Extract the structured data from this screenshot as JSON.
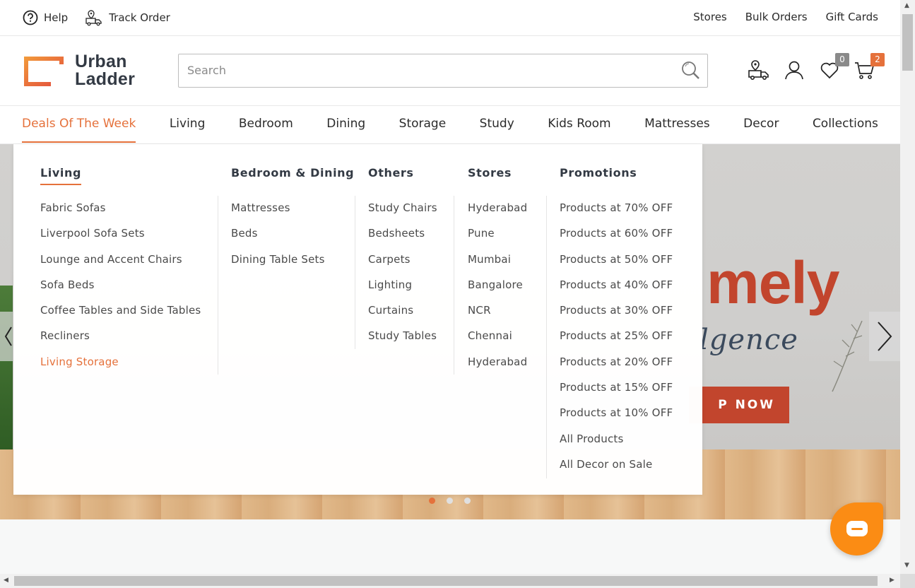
{
  "util": {
    "help": "Help",
    "track_order": "Track Order",
    "stores": "Stores",
    "bulk_orders": "Bulk Orders",
    "gift_cards": "Gift Cards"
  },
  "logo": {
    "line1": "Urban",
    "line2": "Ladder"
  },
  "search": {
    "placeholder": "Search"
  },
  "header_icons": {
    "wishlist_count": "0",
    "cart_count": "2",
    "wishlist_badge_color": "#8a8a8a",
    "cart_badge_color": "#e5713b"
  },
  "nav": {
    "items": [
      "Deals Of The Week",
      "Living",
      "Bedroom",
      "Dining",
      "Storage",
      "Study",
      "Kids Room",
      "Mattresses",
      "Decor",
      "Collections"
    ],
    "active_index": 0
  },
  "mega_menu": {
    "columns": [
      {
        "heading": "Living",
        "items": [
          "Fabric Sofas",
          "Liverpool Sofa Sets",
          "Lounge and Accent Chairs",
          "Sofa Beds",
          "Coffee Tables and Side Tables",
          "Recliners",
          "Living Storage"
        ],
        "highlighted": "Living Storage"
      },
      {
        "heading": "Bedroom & Dining",
        "items": [
          "Mattresses",
          "Beds",
          "Dining Table Sets"
        ]
      },
      {
        "heading": "Others",
        "items": [
          "Study Chairs",
          "Bedsheets",
          "Carpets",
          "Lighting",
          "Curtains",
          "Study Tables"
        ]
      },
      {
        "heading": "Stores",
        "items": [
          "Hyderabad",
          "Pune",
          "Mumbai",
          "Bangalore",
          "NCR",
          "Chennai",
          "Hyderabad"
        ]
      },
      {
        "heading": "Promotions",
        "items": [
          "Products at 70% OFF",
          "Products at 60% OFF",
          "Products at 50% OFF",
          "Products at 40% OFF",
          "Products at 30% OFF",
          "Products at 25% OFF",
          "Products at 20% OFF",
          "Products at 15% OFF",
          "Products at 10% OFF",
          "All Products",
          "All Decor on Sale"
        ]
      }
    ]
  },
  "hero": {
    "headline_fragment": "mely",
    "subline_fragment": "lgence",
    "cta_fragment": "P NOW",
    "active_slide": 1,
    "slide_count": 3
  },
  "colors": {
    "accent": "#e5713b",
    "chat_button": "#fb8c14",
    "hero_red": "#c2452d"
  }
}
